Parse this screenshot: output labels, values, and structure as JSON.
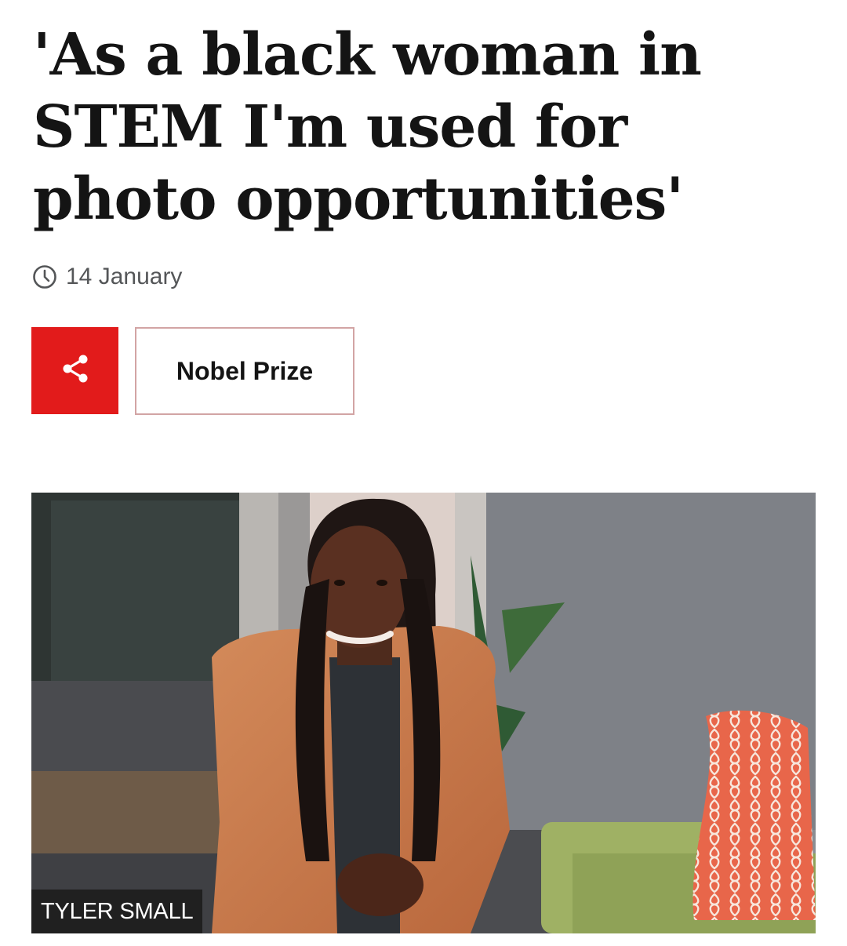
{
  "article": {
    "headline": "'As a black woman in STEM I'm used for photo opportunities'",
    "date": "14 January",
    "clock_icon": "clock-icon",
    "share_icon": "share-icon",
    "topic_label": "Nobel Prize",
    "image_credit": "TYLER SMALL"
  },
  "colors": {
    "accent_red": "#e21b1b",
    "topic_border": "#d2a4a4",
    "text_primary": "#141414",
    "text_meta": "#545658",
    "credit_bg": "#202020"
  }
}
